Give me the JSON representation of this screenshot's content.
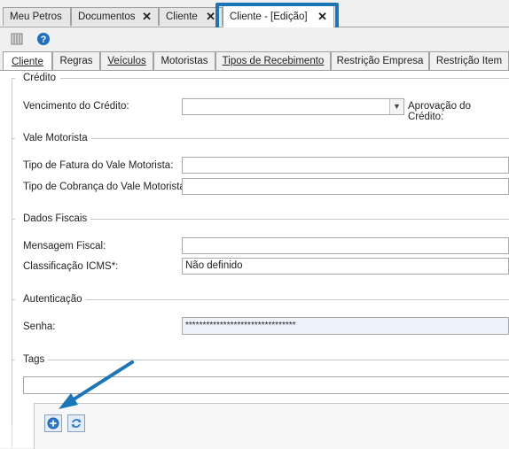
{
  "doc_tabs": [
    {
      "label": "Meu Petros",
      "closable": false
    },
    {
      "label": "Documentos",
      "closable": true
    },
    {
      "label": "Cliente",
      "closable": true
    },
    {
      "label": "Cliente - [Edição]",
      "closable": true,
      "active": true
    }
  ],
  "close_glyph": "✕",
  "form_tabs": [
    "Cliente",
    "Regras",
    "Veículos",
    "Motoristas",
    "Tipos de Recebimento",
    "Restrição Empresa",
    "Restrição Item"
  ],
  "groups": {
    "credito": {
      "title": "Crédito",
      "vencimento_label": "Vencimento do Crédito:",
      "vencimento_value": "",
      "aprovacao_label": "Aprovação do Crédito:"
    },
    "vale": {
      "title": "Vale Motorista",
      "fatura_label": "Tipo de Fatura do Vale Motorista:",
      "fatura_value": "",
      "cobranca_label": "Tipo de Cobrança do Vale Motorista:",
      "cobranca_value": ""
    },
    "fiscais": {
      "title": "Dados Fiscais",
      "mensagem_label": "Mensagem Fiscal:",
      "mensagem_value": "",
      "icms_label": "Classificação ICMS*:",
      "icms_value": "Não definido"
    },
    "autenticacao": {
      "title": "Autenticação",
      "senha_label": "Senha:",
      "senha_value": "********************************"
    },
    "tags": {
      "title": "Tags"
    }
  },
  "colors": {
    "highlight": "#1b76b8",
    "arrow": "#1b76b8"
  }
}
